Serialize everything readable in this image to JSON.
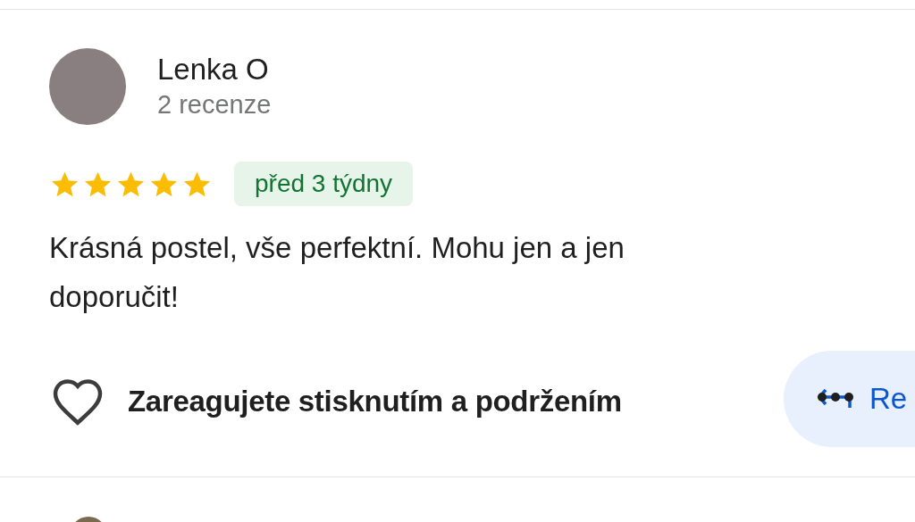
{
  "review": {
    "author": "Lenka O",
    "review_count": "2 recenze",
    "stars": 5,
    "time_badge": "před 3 týdny",
    "text": "Krásná postel, vše perfektní. Mohu jen a jen doporučit!",
    "reaction_hint": "Zareagujete stisknutím a podržením",
    "reply_button": "Re"
  }
}
